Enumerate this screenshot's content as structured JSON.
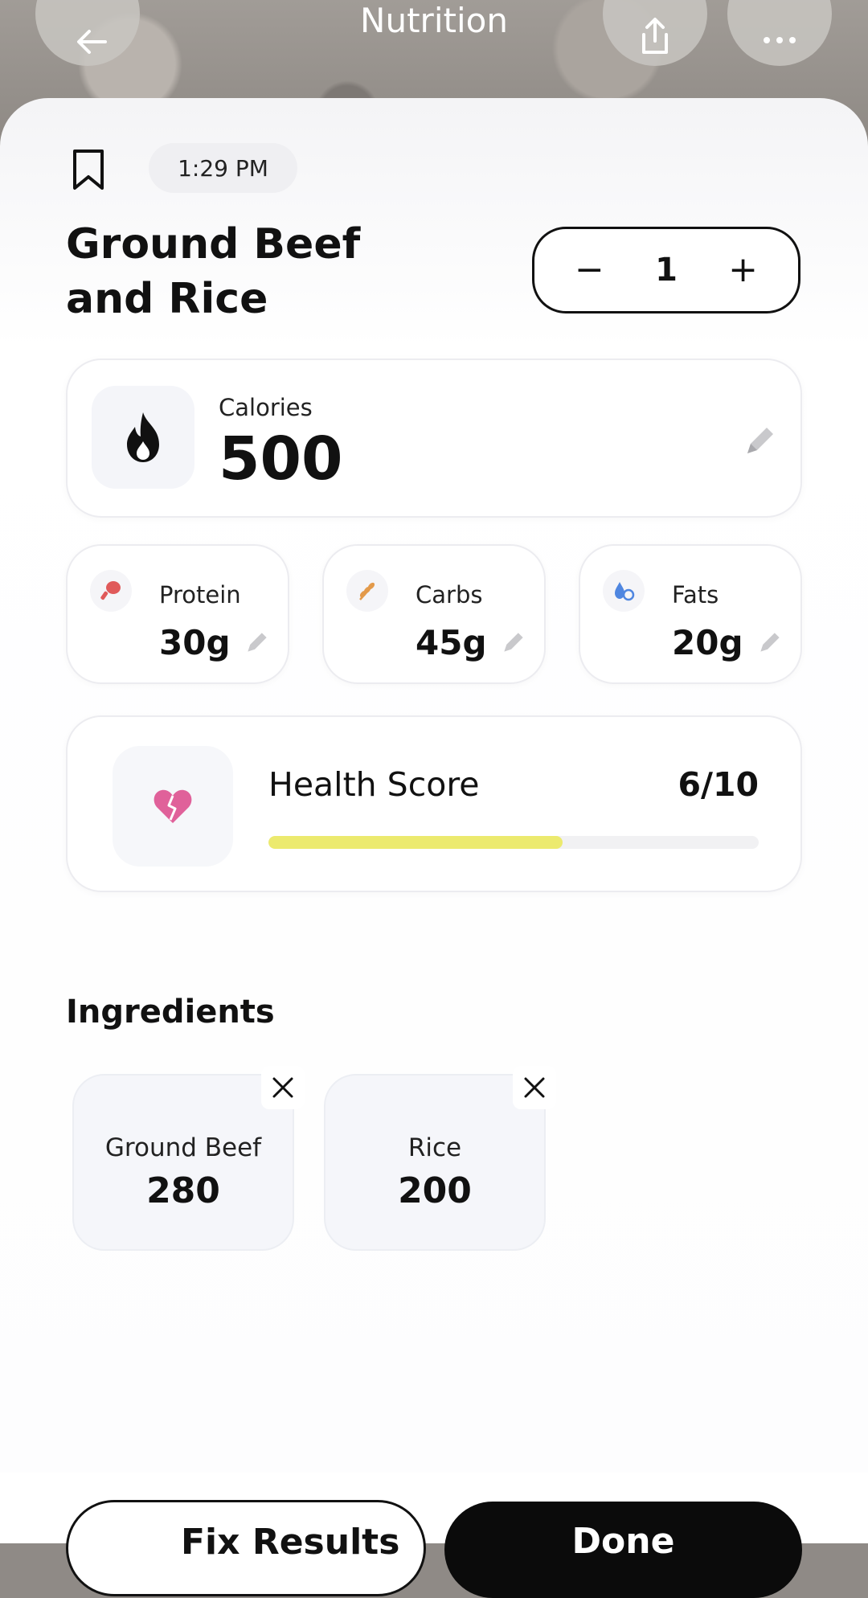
{
  "header": {
    "title": "Nutrition",
    "back_icon": "arrow-left-icon",
    "share_icon": "share-icon",
    "more_icon": "more-horizontal-icon"
  },
  "meal": {
    "time": "1:29 PM",
    "title_line1": "Ground Beef",
    "title_line2": "and Rice",
    "quantity": "1",
    "minus": "−",
    "plus": "+"
  },
  "calories": {
    "label": "Calories",
    "value": "500"
  },
  "macros": [
    {
      "label": "Protein",
      "value": "30g",
      "icon": "drumstick-icon",
      "color": "#e05a5a"
    },
    {
      "label": "Carbs",
      "value": "45g",
      "icon": "wheat-icon",
      "color": "#e39a4a"
    },
    {
      "label": "Fats",
      "value": "20g",
      "icon": "oil-drops-icon",
      "color": "#4f86e0"
    }
  ],
  "health": {
    "label": "Health Score",
    "score": "6/10",
    "fraction": 0.6,
    "bar_color": "#ecea6e",
    "icon": "broken-heart-icon"
  },
  "ingredients": {
    "heading": "Ingredients",
    "items": [
      {
        "name": "Ground Beef",
        "value": "280"
      },
      {
        "name": "Rice",
        "value": "200"
      }
    ]
  },
  "actions": {
    "fix_label": "Fix Results",
    "done_label": "Done"
  }
}
